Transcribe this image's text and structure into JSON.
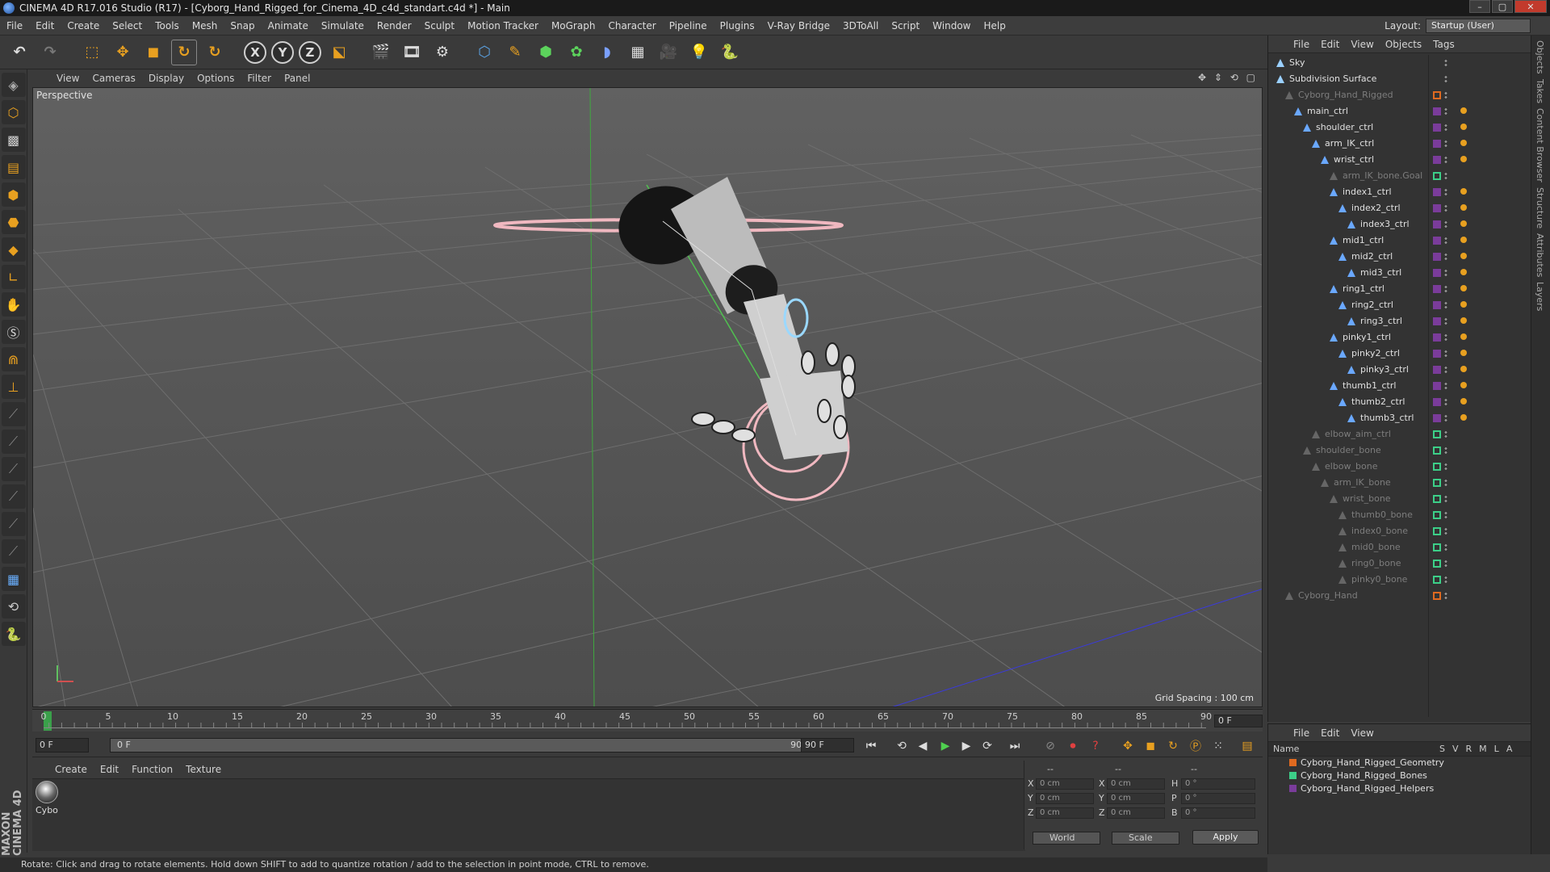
{
  "window": {
    "title": "CINEMA 4D R17.016 Studio (R17) - [Cyborg_Hand_Rigged_for_Cinema_4D_c4d_standart.c4d *] - Main",
    "buttons": [
      "–",
      "▢",
      "✕"
    ]
  },
  "menu": [
    "File",
    "Edit",
    "Create",
    "Select",
    "Tools",
    "Mesh",
    "Snap",
    "Animate",
    "Simulate",
    "Render",
    "Sculpt",
    "Motion Tracker",
    "MoGraph",
    "Character",
    "Pipeline",
    "Plugins",
    "V-Ray Bridge",
    "3DToAll",
    "Script",
    "Window",
    "Help"
  ],
  "layout": {
    "label": "Layout:",
    "value": "Startup (User)"
  },
  "toolbar_axes": [
    "X",
    "Y",
    "Z"
  ],
  "viewport": {
    "menu": [
      "View",
      "Cameras",
      "Display",
      "Options",
      "Filter",
      "Panel"
    ],
    "label": "Perspective",
    "grid_spacing": "Grid Spacing : 100 cm"
  },
  "timeline": {
    "ticks": [
      "0",
      "5",
      "10",
      "15",
      "20",
      "25",
      "30",
      "35",
      "40",
      "45",
      "50",
      "55",
      "60",
      "65",
      "70",
      "75",
      "80",
      "85",
      "90"
    ],
    "current_frame": "0 F"
  },
  "transport": {
    "start": "0 F",
    "slider_start": "0 F",
    "slider_end": "90 F",
    "end": "90 F"
  },
  "material": {
    "menu": [
      "Create",
      "Edit",
      "Function",
      "Texture"
    ],
    "items": [
      {
        "name": "Cybo"
      }
    ]
  },
  "coords": {
    "headers": [
      "--",
      "--",
      "--"
    ],
    "rows": [
      {
        "a": "X",
        "av": "0 cm",
        "b": "X",
        "bv": "0 cm",
        "c": "H",
        "cv": "0 °"
      },
      {
        "a": "Y",
        "av": "0 cm",
        "b": "Y",
        "bv": "0 cm",
        "c": "P",
        "cv": "0 °"
      },
      {
        "a": "Z",
        "av": "0 cm",
        "b": "Z",
        "bv": "0 cm",
        "c": "B",
        "cv": "0 °"
      }
    ],
    "space": "World",
    "mode": "Scale",
    "apply": "Apply"
  },
  "status": "Rotate: Click and drag to rotate elements. Hold down SHIFT to add to quantize rotation / add to the selection in point mode, CTRL to remove.",
  "objects": {
    "menu": [
      "File",
      "Edit",
      "View",
      "Objects",
      "Tags"
    ],
    "items": [
      {
        "name": "Sky",
        "depth": 0,
        "dim": false,
        "tag": "none"
      },
      {
        "name": "Subdivision Surface",
        "depth": 0,
        "dim": false,
        "tag": "none"
      },
      {
        "name": "Cyborg_Hand_Rigged",
        "depth": 1,
        "dim": true,
        "tag": "orange"
      },
      {
        "name": "main_ctrl",
        "depth": 2,
        "dim": false,
        "tag": "purple"
      },
      {
        "name": "shoulder_ctrl",
        "depth": 3,
        "dim": false,
        "tag": "purple"
      },
      {
        "name": "arm_IK_ctrl",
        "depth": 4,
        "dim": false,
        "tag": "purple"
      },
      {
        "name": "wrist_ctrl",
        "depth": 5,
        "dim": false,
        "tag": "purple"
      },
      {
        "name": "arm_IK_bone.Goal",
        "depth": 6,
        "dim": true,
        "tag": "green"
      },
      {
        "name": "index1_ctrl",
        "depth": 6,
        "dim": false,
        "tag": "purple"
      },
      {
        "name": "index2_ctrl",
        "depth": 7,
        "dim": false,
        "tag": "purple"
      },
      {
        "name": "index3_ctrl",
        "depth": 8,
        "dim": false,
        "tag": "purple"
      },
      {
        "name": "mid1_ctrl",
        "depth": 6,
        "dim": false,
        "tag": "purple"
      },
      {
        "name": "mid2_ctrl",
        "depth": 7,
        "dim": false,
        "tag": "purple"
      },
      {
        "name": "mid3_ctrl",
        "depth": 8,
        "dim": false,
        "tag": "purple"
      },
      {
        "name": "ring1_ctrl",
        "depth": 6,
        "dim": false,
        "tag": "purple"
      },
      {
        "name": "ring2_ctrl",
        "depth": 7,
        "dim": false,
        "tag": "purple"
      },
      {
        "name": "ring3_ctrl",
        "depth": 8,
        "dim": false,
        "tag": "purple"
      },
      {
        "name": "pinky1_ctrl",
        "depth": 6,
        "dim": false,
        "tag": "purple"
      },
      {
        "name": "pinky2_ctrl",
        "depth": 7,
        "dim": false,
        "tag": "purple"
      },
      {
        "name": "pinky3_ctrl",
        "depth": 8,
        "dim": false,
        "tag": "purple"
      },
      {
        "name": "thumb1_ctrl",
        "depth": 6,
        "dim": false,
        "tag": "purple"
      },
      {
        "name": "thumb2_ctrl",
        "depth": 7,
        "dim": false,
        "tag": "purple"
      },
      {
        "name": "thumb3_ctrl",
        "depth": 8,
        "dim": false,
        "tag": "purple"
      },
      {
        "name": "elbow_aim_ctrl",
        "depth": 4,
        "dim": true,
        "tag": "green"
      },
      {
        "name": "shoulder_bone",
        "depth": 3,
        "dim": true,
        "tag": "green"
      },
      {
        "name": "elbow_bone",
        "depth": 4,
        "dim": true,
        "tag": "green"
      },
      {
        "name": "arm_IK_bone",
        "depth": 5,
        "dim": true,
        "tag": "green"
      },
      {
        "name": "wrist_bone",
        "depth": 6,
        "dim": true,
        "tag": "green"
      },
      {
        "name": "thumb0_bone",
        "depth": 7,
        "dim": true,
        "tag": "green"
      },
      {
        "name": "index0_bone",
        "depth": 7,
        "dim": true,
        "tag": "green"
      },
      {
        "name": "mid0_bone",
        "depth": 7,
        "dim": true,
        "tag": "green"
      },
      {
        "name": "ring0_bone",
        "depth": 7,
        "dim": true,
        "tag": "green"
      },
      {
        "name": "pinky0_bone",
        "depth": 7,
        "dim": true,
        "tag": "green"
      },
      {
        "name": "Cyborg_Hand",
        "depth": 1,
        "dim": true,
        "tag": "orange"
      }
    ]
  },
  "layers": {
    "menu": [
      "File",
      "Edit",
      "View"
    ],
    "columns": [
      "Name",
      "S",
      "V",
      "R",
      "M",
      "L",
      "A"
    ],
    "items": [
      {
        "name": "Cyborg_Hand_Rigged_Geometry",
        "color": "#e06a20"
      },
      {
        "name": "Cyborg_Hand_Rigged_Bones",
        "color": "#3ccf88"
      },
      {
        "name": "Cyborg_Hand_Rigged_Helpers",
        "color": "#7a3c9a"
      }
    ]
  },
  "right_tabs": [
    "Objects",
    "Takes",
    "Content Browser",
    "Structure",
    "Attributes",
    "Layers"
  ]
}
